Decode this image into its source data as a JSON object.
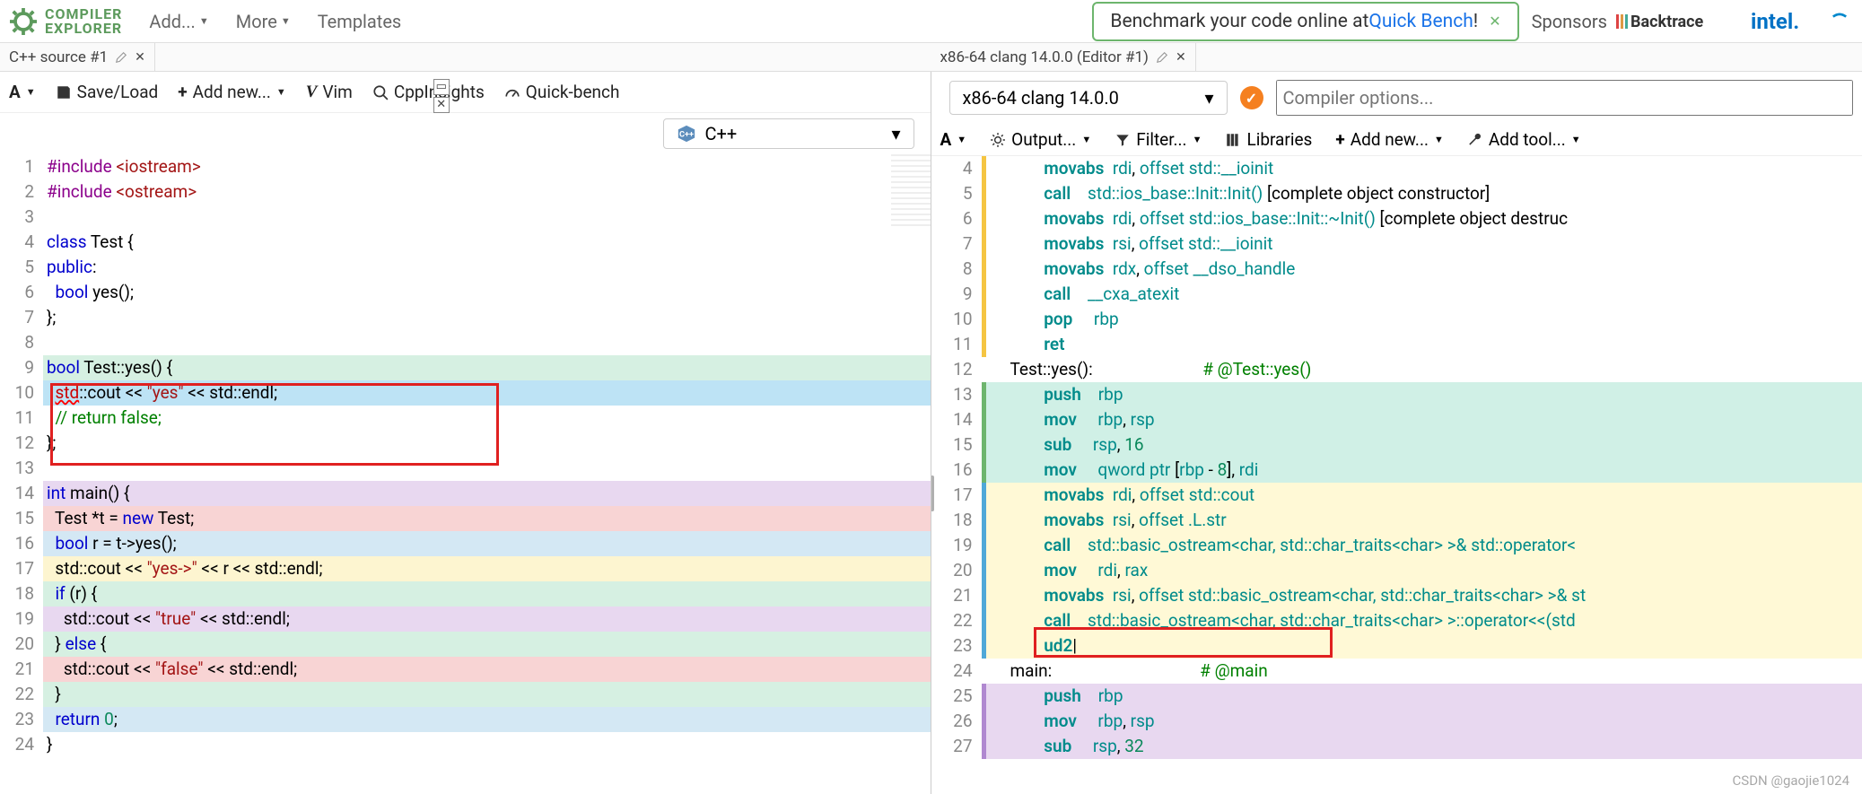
{
  "header": {
    "logo_top": "COMPILER",
    "logo_bottom": "EXPLORER",
    "menu": [
      "Add...",
      "More",
      "Templates"
    ],
    "banner_prefix": "Benchmark your code online at ",
    "banner_link": "Quick Bench",
    "banner_suffix": "!",
    "sponsors_label": "Sponsors"
  },
  "left": {
    "tab_title": "C++ source #1",
    "toolbar": {
      "font": "A",
      "save": "Save/Load",
      "addnew": "Add new...",
      "vim": "Vim",
      "cppinsights": "CppInsights",
      "quickbench": "Quick-bench"
    },
    "lang": "C++",
    "gutters": [
      "1",
      "2",
      "3",
      "4",
      "5",
      "6",
      "7",
      "8",
      "9",
      "10",
      "11",
      "12",
      "13",
      "14",
      "15",
      "16",
      "17",
      "18",
      "19",
      "20",
      "21",
      "22",
      "23",
      "24"
    ],
    "code": [
      {
        "hl": "",
        "tokens": [
          [
            "pp",
            "#include "
          ],
          [
            "str",
            "<iostream>"
          ]
        ]
      },
      {
        "hl": "",
        "tokens": [
          [
            "pp",
            "#include "
          ],
          [
            "str",
            "<ostream>"
          ]
        ]
      },
      {
        "hl": "",
        "tokens": [
          [
            "",
            ""
          ]
        ]
      },
      {
        "hl": "",
        "tokens": [
          [
            "kw",
            "class"
          ],
          [
            "",
            " Test {"
          ]
        ]
      },
      {
        "hl": "",
        "tokens": [
          [
            "kw",
            "public"
          ],
          [
            "",
            ":"
          ]
        ]
      },
      {
        "hl": "",
        "tokens": [
          [
            "",
            "  "
          ],
          [
            "kw",
            "bool"
          ],
          [
            "",
            " yes();"
          ]
        ]
      },
      {
        "hl": "",
        "tokens": [
          [
            "",
            "};"
          ]
        ]
      },
      {
        "hl": "",
        "tokens": [
          [
            "",
            ""
          ]
        ]
      },
      {
        "hl": "green",
        "tokens": [
          [
            "kw",
            "bool"
          ],
          [
            "",
            " Test::yes() {"
          ]
        ]
      },
      {
        "hl": "sel",
        "tokens": [
          [
            "",
            "  "
          ],
          [
            "err",
            "std"
          ],
          [
            "",
            "::cout << "
          ],
          [
            "str",
            "\"yes\""
          ],
          [
            "",
            " << std::endl;"
          ]
        ]
      },
      {
        "hl": "",
        "tokens": [
          [
            "",
            "  "
          ],
          [
            "cmt",
            "// return false;"
          ]
        ]
      },
      {
        "hl": "",
        "tokens": [
          [
            "",
            "};"
          ]
        ]
      },
      {
        "hl": "",
        "tokens": [
          [
            "",
            ""
          ]
        ]
      },
      {
        "hl": "purple",
        "tokens": [
          [
            "kw",
            "int"
          ],
          [
            "",
            " main() {"
          ]
        ]
      },
      {
        "hl": "pink",
        "tokens": [
          [
            "",
            "  Test *t = "
          ],
          [
            "kw",
            "new"
          ],
          [
            "",
            " Test;"
          ]
        ]
      },
      {
        "hl": "blue",
        "tokens": [
          [
            "",
            "  "
          ],
          [
            "kw",
            "bool"
          ],
          [
            "",
            " r = t->yes();"
          ]
        ]
      },
      {
        "hl": "yellow",
        "tokens": [
          [
            "",
            "  std::cout << "
          ],
          [
            "str",
            "\"yes->\""
          ],
          [
            "",
            " << r << std::endl;"
          ]
        ]
      },
      {
        "hl": "green",
        "tokens": [
          [
            "",
            "  "
          ],
          [
            "kw",
            "if"
          ],
          [
            "",
            " (r) {"
          ]
        ]
      },
      {
        "hl": "purple",
        "tokens": [
          [
            "",
            "    std::cout << "
          ],
          [
            "str",
            "\"true\""
          ],
          [
            "",
            " << std::endl;"
          ]
        ]
      },
      {
        "hl": "green",
        "tokens": [
          [
            "",
            "  } "
          ],
          [
            "kw",
            "else"
          ],
          [
            "",
            " {"
          ]
        ]
      },
      {
        "hl": "pink",
        "tokens": [
          [
            "",
            "    std::cout << "
          ],
          [
            "str",
            "\"false\""
          ],
          [
            "",
            " << std::endl;"
          ]
        ]
      },
      {
        "hl": "green",
        "tokens": [
          [
            "",
            "  }"
          ]
        ]
      },
      {
        "hl": "blue",
        "tokens": [
          [
            "",
            "  "
          ],
          [
            "kw",
            "return"
          ],
          [
            "",
            " "
          ],
          [
            "num",
            "0"
          ],
          [
            "",
            ";"
          ]
        ]
      },
      {
        "hl": "",
        "tokens": [
          [
            "",
            "}"
          ]
        ]
      }
    ]
  },
  "right": {
    "tab_title": "x86-64 clang 14.0.0 (Editor #1)",
    "compiler": "x86-64 clang 14.0.0",
    "compiler_opts_placeholder": "Compiler options...",
    "toolbar": {
      "font": "A",
      "output": "Output...",
      "filter": "Filter...",
      "libraries": "Libraries",
      "addnew": "Add new...",
      "addtool": "Add tool..."
    },
    "gutters": [
      "4",
      "5",
      "6",
      "7",
      "8",
      "9",
      "10",
      "11",
      "12",
      "13",
      "14",
      "15",
      "16",
      "17",
      "18",
      "19",
      "20",
      "21",
      "22",
      "23",
      "24",
      "25",
      "26",
      "27"
    ],
    "asm": [
      {
        "bar": "#f5c542",
        "hl": "",
        "ind": 2,
        "tokens": [
          [
            "op",
            "movabs"
          ],
          [
            "",
            "  "
          ],
          [
            "reg",
            "rdi"
          ],
          [
            "",
            ", "
          ],
          [
            "call",
            "offset std::__ioinit"
          ]
        ]
      },
      {
        "bar": "#f5c542",
        "hl": "",
        "ind": 2,
        "tokens": [
          [
            "op",
            "call"
          ],
          [
            "",
            "    "
          ],
          [
            "call",
            "std::ios_base::Init::Init() "
          ],
          [
            "",
            "[complete object constructor]"
          ]
        ]
      },
      {
        "bar": "#f5c542",
        "hl": "",
        "ind": 2,
        "tokens": [
          [
            "op",
            "movabs"
          ],
          [
            "",
            "  "
          ],
          [
            "reg",
            "rdi"
          ],
          [
            "",
            ", "
          ],
          [
            "call",
            "offset std::ios_base::Init::~Init() "
          ],
          [
            "",
            "[complete object destruc"
          ]
        ]
      },
      {
        "bar": "#f5c542",
        "hl": "",
        "ind": 2,
        "tokens": [
          [
            "op",
            "movabs"
          ],
          [
            "",
            "  "
          ],
          [
            "reg",
            "rsi"
          ],
          [
            "",
            ", "
          ],
          [
            "call",
            "offset std::__ioinit"
          ]
        ]
      },
      {
        "bar": "#f5c542",
        "hl": "",
        "ind": 2,
        "tokens": [
          [
            "op",
            "movabs"
          ],
          [
            "",
            "  "
          ],
          [
            "reg",
            "rdx"
          ],
          [
            "",
            ", "
          ],
          [
            "call",
            "offset __dso_handle"
          ]
        ]
      },
      {
        "bar": "#f5c542",
        "hl": "",
        "ind": 2,
        "tokens": [
          [
            "op",
            "call"
          ],
          [
            "",
            "    "
          ],
          [
            "call",
            "__cxa_atexit"
          ]
        ]
      },
      {
        "bar": "#f5c542",
        "hl": "",
        "ind": 2,
        "tokens": [
          [
            "op",
            "pop"
          ],
          [
            "",
            "     "
          ],
          [
            "reg",
            "rbp"
          ]
        ]
      },
      {
        "bar": "#f5c542",
        "hl": "",
        "ind": 2,
        "tokens": [
          [
            "op",
            "ret"
          ],
          [
            "",
            ""
          ]
        ]
      },
      {
        "bar": "",
        "hl": "",
        "ind": 0,
        "tokens": [
          [
            "label",
            "Test::yes():"
          ],
          [
            "",
            "                          "
          ],
          [
            "cmt",
            "# @Test::yes()"
          ]
        ]
      },
      {
        "bar": "#6db56d",
        "hl": "cyan",
        "ind": 2,
        "tokens": [
          [
            "op",
            "push"
          ],
          [
            "",
            "    "
          ],
          [
            "reg",
            "rbp"
          ]
        ]
      },
      {
        "bar": "#6db56d",
        "hl": "cyan",
        "ind": 2,
        "tokens": [
          [
            "op",
            "mov"
          ],
          [
            "",
            "     "
          ],
          [
            "reg",
            "rbp"
          ],
          [
            "",
            ", "
          ],
          [
            "reg",
            "rsp"
          ]
        ]
      },
      {
        "bar": "#6db56d",
        "hl": "cyan",
        "ind": 2,
        "tokens": [
          [
            "op",
            "sub"
          ],
          [
            "",
            "     "
          ],
          [
            "reg",
            "rsp"
          ],
          [
            "",
            ", "
          ],
          [
            "num",
            "16"
          ]
        ]
      },
      {
        "bar": "#6db56d",
        "hl": "cyan",
        "ind": 2,
        "tokens": [
          [
            "op",
            "mov"
          ],
          [
            "",
            "     "
          ],
          [
            "call",
            "qword ptr"
          ],
          [
            "",
            " ["
          ],
          [
            "reg",
            "rbp"
          ],
          [
            "",
            " - "
          ],
          [
            "num",
            "8"
          ],
          [
            "",
            "], "
          ],
          [
            "reg",
            "rdi"
          ]
        ]
      },
      {
        "bar": "#4fa8d8",
        "hl": "ylw",
        "ind": 2,
        "tokens": [
          [
            "op",
            "movabs"
          ],
          [
            "",
            "  "
          ],
          [
            "reg",
            "rdi"
          ],
          [
            "",
            ", "
          ],
          [
            "call",
            "offset std::cout"
          ]
        ]
      },
      {
        "bar": "#4fa8d8",
        "hl": "ylw",
        "ind": 2,
        "tokens": [
          [
            "op",
            "movabs"
          ],
          [
            "",
            "  "
          ],
          [
            "reg",
            "rsi"
          ],
          [
            "",
            ", "
          ],
          [
            "call",
            "offset .L.str"
          ]
        ]
      },
      {
        "bar": "#4fa8d8",
        "hl": "ylw",
        "ind": 2,
        "tokens": [
          [
            "op",
            "call"
          ],
          [
            "",
            "    "
          ],
          [
            "call",
            "std::basic_ostream<char, std::char_traits<char> >& std::operator<"
          ]
        ]
      },
      {
        "bar": "#4fa8d8",
        "hl": "ylw",
        "ind": 2,
        "tokens": [
          [
            "op",
            "mov"
          ],
          [
            "",
            "     "
          ],
          [
            "reg",
            "rdi"
          ],
          [
            "",
            ", "
          ],
          [
            "reg",
            "rax"
          ]
        ]
      },
      {
        "bar": "#4fa8d8",
        "hl": "ylw",
        "ind": 2,
        "tokens": [
          [
            "op",
            "movabs"
          ],
          [
            "",
            "  "
          ],
          [
            "reg",
            "rsi"
          ],
          [
            "",
            ", "
          ],
          [
            "call",
            "offset std::basic_ostream<char, std::char_traits<char> >& st"
          ]
        ]
      },
      {
        "bar": "#4fa8d8",
        "hl": "ylw",
        "ind": 2,
        "tokens": [
          [
            "op",
            "call"
          ],
          [
            "",
            "    "
          ],
          [
            "call",
            "std::basic_ostream<char, std::char_traits<char> >::operator<<(std"
          ]
        ]
      },
      {
        "bar": "#4fa8d8",
        "hl": "ylw",
        "ind": 2,
        "tokens": [
          [
            "op",
            "ud2"
          ],
          [
            "",
            ""
          ]
        ],
        "cursor": true
      },
      {
        "bar": "",
        "hl": "",
        "ind": 0,
        "tokens": [
          [
            "label",
            "main:"
          ],
          [
            "",
            "                                   "
          ],
          [
            "cmt",
            "# @main"
          ]
        ]
      },
      {
        "bar": "#b088d0",
        "hl": "purple",
        "ind": 2,
        "tokens": [
          [
            "op",
            "push"
          ],
          [
            "",
            "    "
          ],
          [
            "reg",
            "rbp"
          ]
        ]
      },
      {
        "bar": "#b088d0",
        "hl": "purple",
        "ind": 2,
        "tokens": [
          [
            "op",
            "mov"
          ],
          [
            "",
            "     "
          ],
          [
            "reg",
            "rbp"
          ],
          [
            "",
            ", "
          ],
          [
            "reg",
            "rsp"
          ]
        ]
      },
      {
        "bar": "#b088d0",
        "hl": "purple",
        "ind": 2,
        "tokens": [
          [
            "op",
            "sub"
          ],
          [
            "",
            "     "
          ],
          [
            "reg",
            "rsp"
          ],
          [
            "",
            ", "
          ],
          [
            "num",
            "32"
          ]
        ]
      }
    ]
  },
  "watermark": "CSDN @gaojie1024"
}
